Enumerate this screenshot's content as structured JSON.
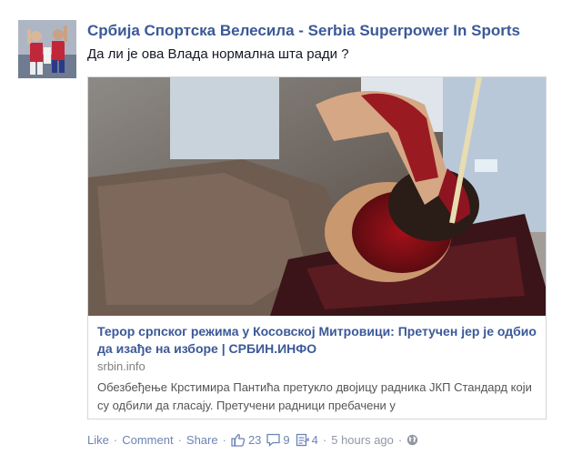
{
  "post": {
    "page_name": "Србија Спортска Велесила - Serbia Superpower In Sports",
    "message": "Да ли је ова Влада нормална шта ради ?"
  },
  "attachment": {
    "title": "Терор српског режима у Косовској Митровици: Претучен јер је одбио да изађе на изборе | СРБИН.ИНФО",
    "source": "srbin.info",
    "description": "Обезбеђење Крстимира Пантића претукло двојицу радника ЈКП Стандард који су одбили да гласају. Претучени радници пребачени у"
  },
  "actions": {
    "like_label": "Like",
    "comment_label": "Comment",
    "share_label": "Share",
    "separator": "·",
    "likes_count": "23",
    "comments_count": "9",
    "shares_count": "4",
    "timestamp": "5 hours ago",
    "icons": [
      "thumbs-up-icon",
      "comment-bubble-icon",
      "share-icon",
      "globe-icon"
    ]
  },
  "colors": {
    "link": "#3b5998",
    "action_link": "#6d84b4",
    "meta": "#9197a3",
    "text": "#141823",
    "border": "#d3d6db"
  }
}
